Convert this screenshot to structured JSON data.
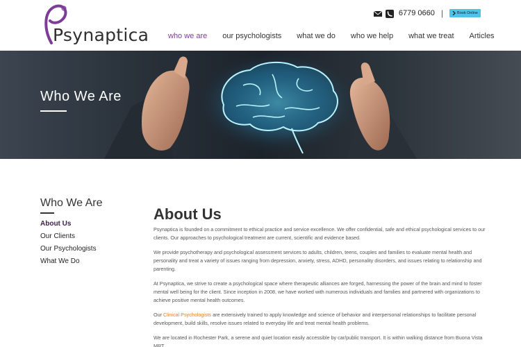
{
  "header": {
    "logo_text": "Psynaptica",
    "phone": "6779 0660",
    "separator": "|",
    "book_label": "Book Online",
    "nav": [
      "who we are",
      "our psychologists",
      "what we do",
      "who we help",
      "what we treat",
      "Articles"
    ]
  },
  "hero": {
    "title": "Who We Are"
  },
  "sidebar": {
    "title": "Who We Are",
    "items": [
      "About Us",
      "Our Clients",
      "Our Psychologists",
      "What We Do"
    ]
  },
  "main": {
    "title": "About Us",
    "p1": "Psynaptica is founded on a commitment to ethical practice and service excellence. We offer confidential, safe and ethical psychological services to our clients. Our approaches to psychological treatment are current, scientific and evidence based.",
    "p2": "We provide psychotherapy and psychological assessment services to adults, children, teens, couples and families to evaluate mental health and personality and treat a variety of issues  ranging from depression, anxiety, stress, ADHD, personality disorders, and issues relating to relationship and parenting.",
    "p3": "At Psynaptica, we strive to create a psychological space where therapeutic alliances are forged, harnessing the power of the brain and mind to foster mental well being for the client.  Since inception in 2008, we have worked with numerous individuals and families and partnered with organizations to achieve positive mental health outcomes.",
    "p4_prefix": "Our ",
    "p4_link": "Clinical Psychologists",
    "p4_rest": " are extensively trained to apply knowledge and science of behavior and interpersonal relationships to facilitate personal development, build skills, resolve issues related to everyday life and treat mental health problems.",
    "p5": "We are located in Rochester Park, a serene and quiet location easily accessible by car/public transport. It is within walking distance from Buona Vista MRT."
  },
  "colors": {
    "accent_purple": "#7d3c98",
    "book_button": "#4fc3e8",
    "link_orange": "#e67e22"
  },
  "icons": [
    "envelope-icon",
    "phone-icon",
    "chevron-right-icon",
    "brain-icon"
  ]
}
